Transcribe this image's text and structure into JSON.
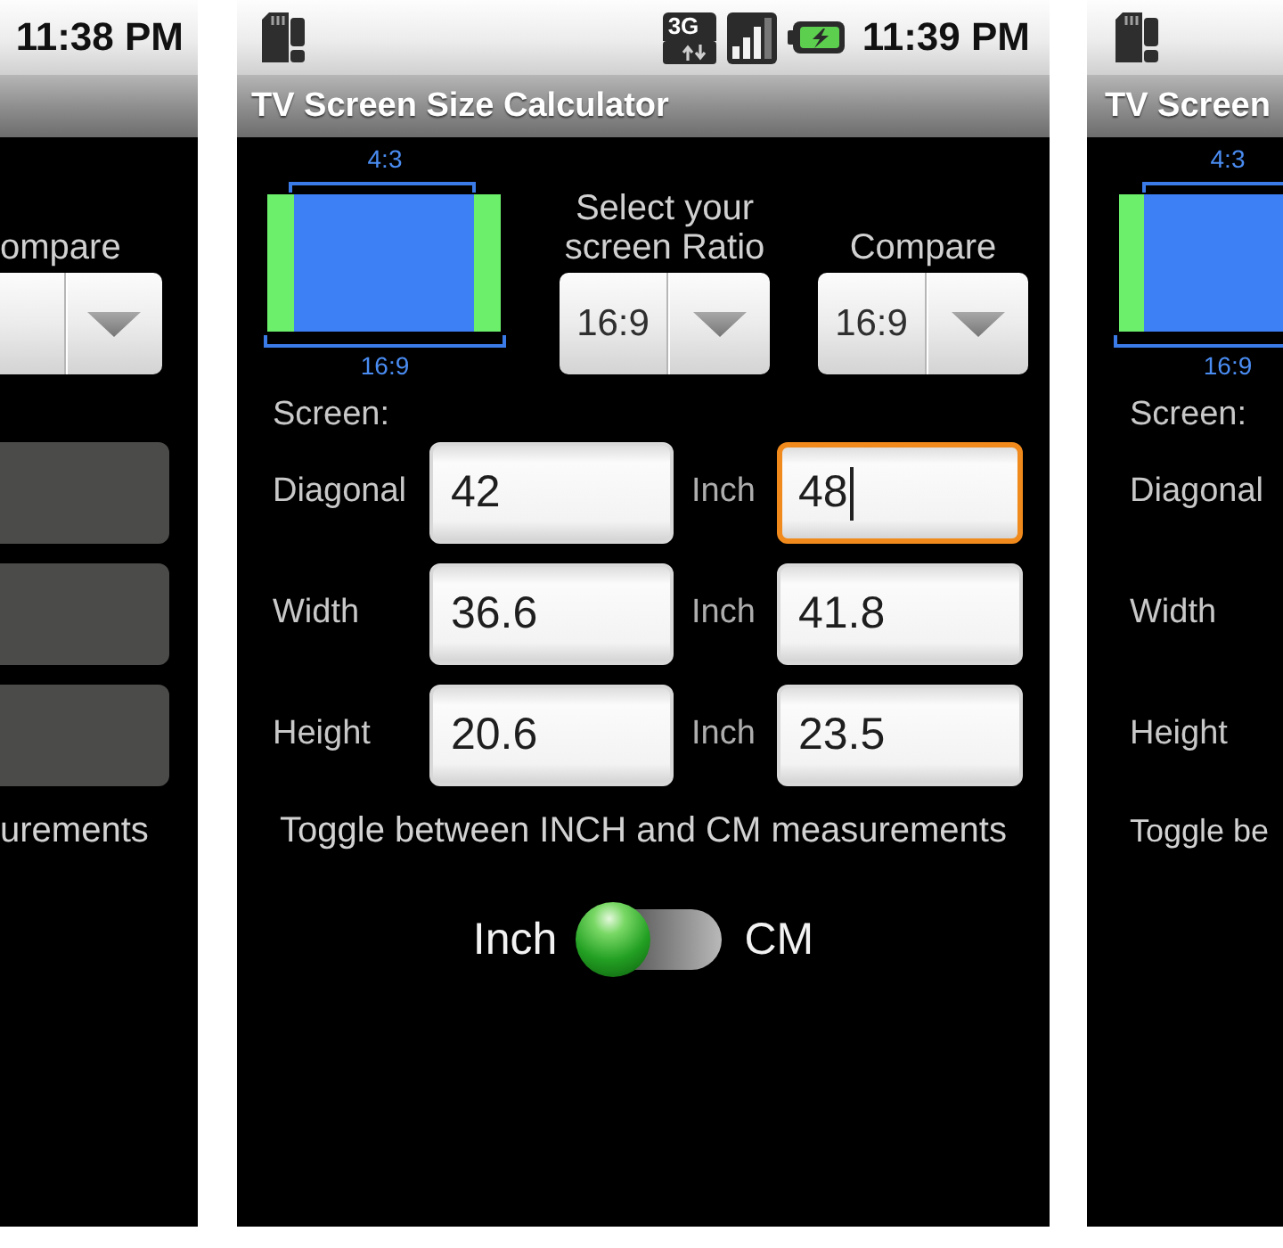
{
  "phones": [
    {
      "kind": "right_edge",
      "status_bar": {
        "time": "11:38 PM"
      },
      "compare": {
        "label": "ompare"
      },
      "rows": [
        {
          "compare_field": {
            "disabled": true
          }
        },
        {
          "compare_field": {
            "disabled": true
          }
        },
        {
          "compare_field": {
            "disabled": true
          }
        }
      ],
      "toggle_caption": "urements"
    },
    {
      "kind": "full",
      "status_bar": {
        "network": "3G",
        "time": "11:39 PM"
      },
      "title": "TV Screen Size Calculator",
      "preview": {
        "top_label": "4:3",
        "bottom_label": "16:9"
      },
      "ratio": {
        "label": "Select your screen Ratio",
        "value": "16:9"
      },
      "compare": {
        "label": "Compare",
        "value": "16:9"
      },
      "screen_label": "Screen:",
      "rows": [
        {
          "label": "Diagonal",
          "field": {
            "value": "42",
            "disabled": false,
            "focused": false
          },
          "unit": "Inch",
          "compare_field": {
            "value": "48",
            "disabled": false,
            "focused": true
          }
        },
        {
          "label": "Width",
          "field": {
            "value": "36.6",
            "disabled": false,
            "focused": false
          },
          "unit": "Inch",
          "compare_field": {
            "value": "41.8",
            "disabled": false,
            "focused": false
          }
        },
        {
          "label": "Height",
          "field": {
            "value": "20.6",
            "disabled": false,
            "focused": false
          },
          "unit": "Inch",
          "compare_field": {
            "value": "23.5",
            "disabled": false,
            "focused": false
          }
        }
      ],
      "toggle_caption": "Toggle between INCH and CM measurements",
      "unit_switch": {
        "left_label": "Inch",
        "right_label": "CM",
        "on": false
      }
    },
    {
      "kind": "left_edge",
      "title": "TV Screen",
      "preview": {
        "top_label": "4:3",
        "bottom_label": "16:9"
      },
      "screen_label": "Screen:",
      "rows": [
        {
          "label": "Diagonal"
        },
        {
          "label": "Width"
        },
        {
          "label": "Height"
        }
      ],
      "toggle_caption": "Toggle be"
    }
  ]
}
